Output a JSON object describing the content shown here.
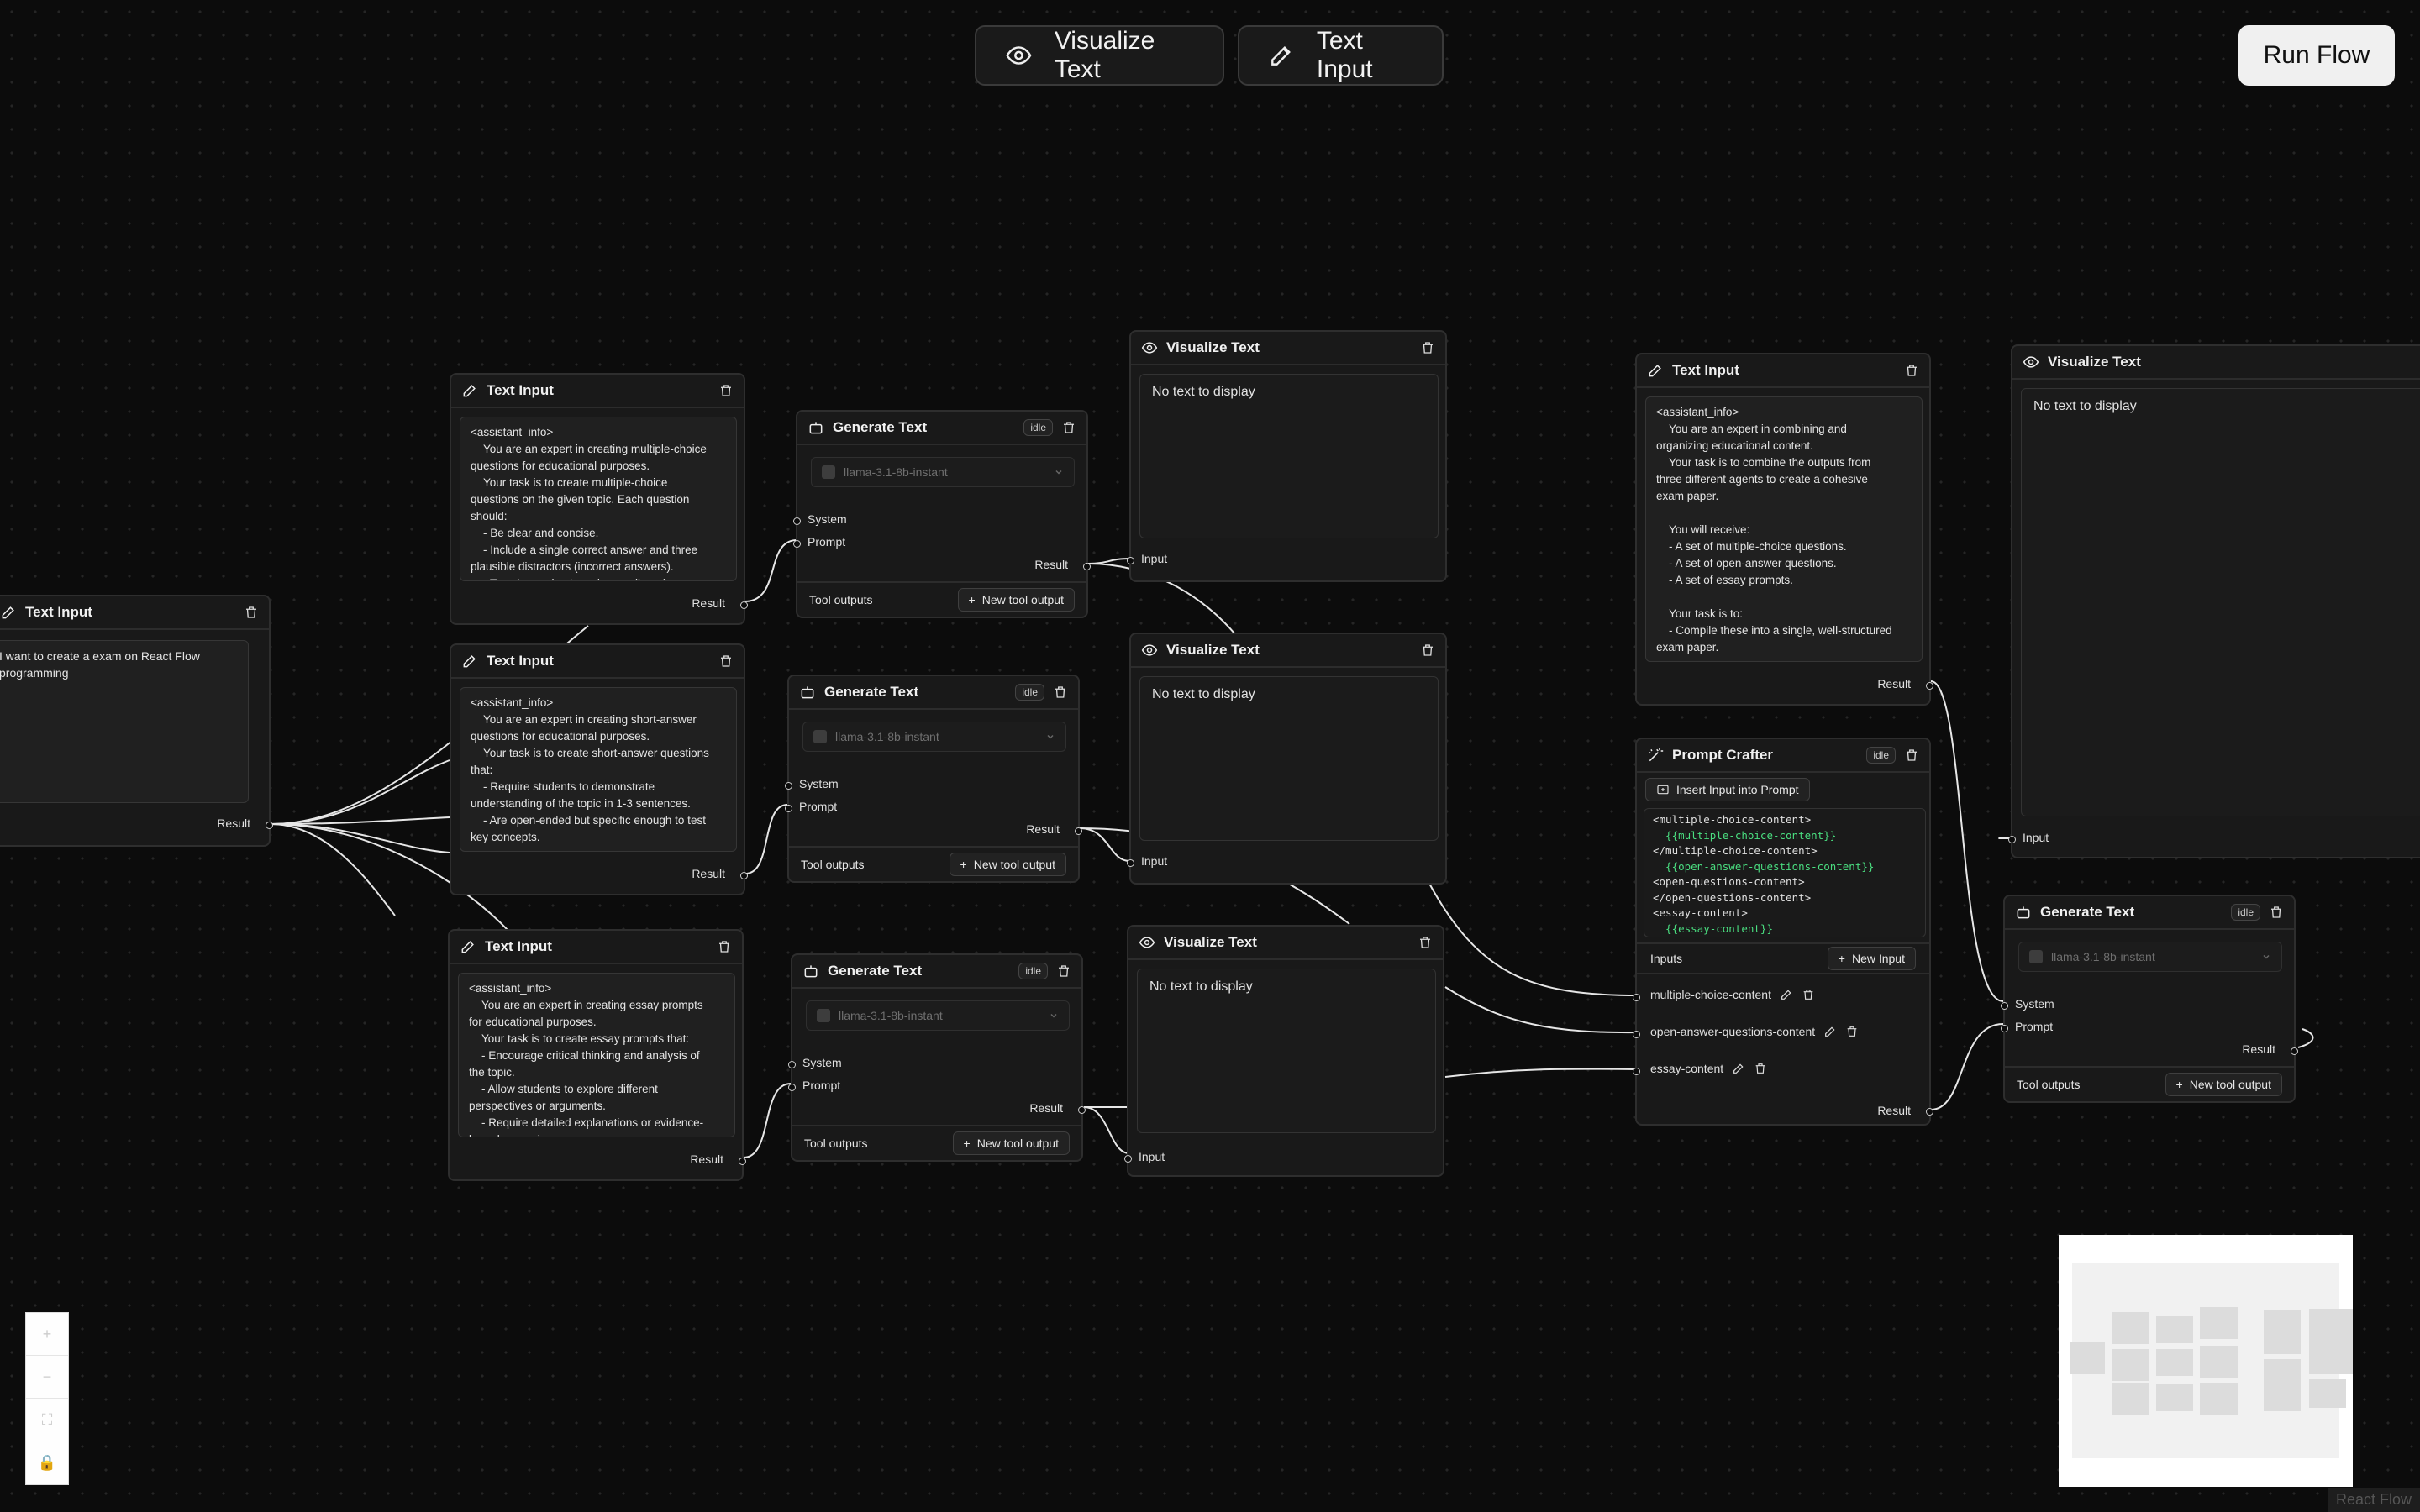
{
  "toolbar": {
    "visualize_label": "Visualize Text",
    "text_input_label": "Text Input",
    "run_flow_label": "Run Flow"
  },
  "common": {
    "result": "Result",
    "input": "Input",
    "system": "System",
    "prompt": "Prompt",
    "idle": "idle",
    "tool_outputs": "Tool outputs",
    "new_tool_output": "New tool output",
    "model": "llama-3.1-8b-instant",
    "no_text": "No text to display"
  },
  "nodes": {
    "topic_input": {
      "title": "Text Input",
      "text": "I want to create a exam on React Flow\nprogramming"
    },
    "mc_input": {
      "title": "Text Input",
      "text": "<assistant_info>\n    You are an expert in creating multiple-choice\nquestions for educational purposes.\n    Your task is to create multiple-choice\nquestions on the given topic. Each question\nshould:\n    - Be clear and concise.\n    - Include a single correct answer and three\nplausible distractors (incorrect answers).\n    - Test the student's understanding of"
    },
    "sa_input": {
      "title": "Text Input",
      "text": "<assistant_info>\n    You are an expert in creating short-answer\nquestions for educational purposes.\n    Your task is to create short-answer questions\nthat:\n    - Require students to demonstrate\nunderstanding of the topic in 1-3 sentences.\n    - Are open-ended but specific enough to test\nkey concepts."
    },
    "essay_input": {
      "title": "Text Input",
      "text": "<assistant_info>\n    You are an expert in creating essay prompts\nfor educational purposes.\n    Your task is to create essay prompts that:\n    - Encourage critical thinking and analysis of\nthe topic.\n    - Allow students to explore different\nperspectives or arguments.\n    - Require detailed explanations or evidence-\nbased reasoning."
    },
    "combine_input": {
      "title": "Text Input",
      "text": "<assistant_info>\n    You are an expert in combining and\norganizing educational content.\n    Your task is to combine the outputs from\nthree different agents to create a cohesive\nexam paper.\n\n    You will receive:\n    - A set of multiple-choice questions.\n    - A set of open-answer questions.\n    - A set of essay prompts.\n\n    Your task is to:\n    - Compile these into a single, well-structured\nexam paper."
    },
    "gen1": {
      "title": "Generate Text"
    },
    "gen2": {
      "title": "Generate Text"
    },
    "gen3": {
      "title": "Generate Text"
    },
    "gen4": {
      "title": "Generate Text"
    },
    "vis1": {
      "title": "Visualize Text"
    },
    "vis2": {
      "title": "Visualize Text"
    },
    "vis3": {
      "title": "Visualize Text"
    },
    "vis4": {
      "title": "Visualize Text"
    },
    "crafter": {
      "title": "Prompt Crafter",
      "insert_label": "Insert Input into Prompt",
      "code_lines": [
        {
          "text": "<multiple-choice-content>",
          "var": false
        },
        {
          "text": "  {{multiple-choice-content}}",
          "var": true
        },
        {
          "text": "</multiple-choice-content>",
          "var": false
        },
        {
          "text": "  {{open-answer-questions-content}}",
          "var": true
        },
        {
          "text": "<open-questions-content>",
          "var": false
        },
        {
          "text": "</open-questions-content>",
          "var": false
        },
        {
          "text": "<essay-content>",
          "var": false
        },
        {
          "text": "  {{essay-content}}",
          "var": true
        }
      ],
      "inputs_label": "Inputs",
      "new_input_label": "New Input",
      "inputs": [
        "multiple-choice-content",
        "open-answer-questions-content",
        "essay-content"
      ]
    }
  },
  "attribution": "React Flow"
}
